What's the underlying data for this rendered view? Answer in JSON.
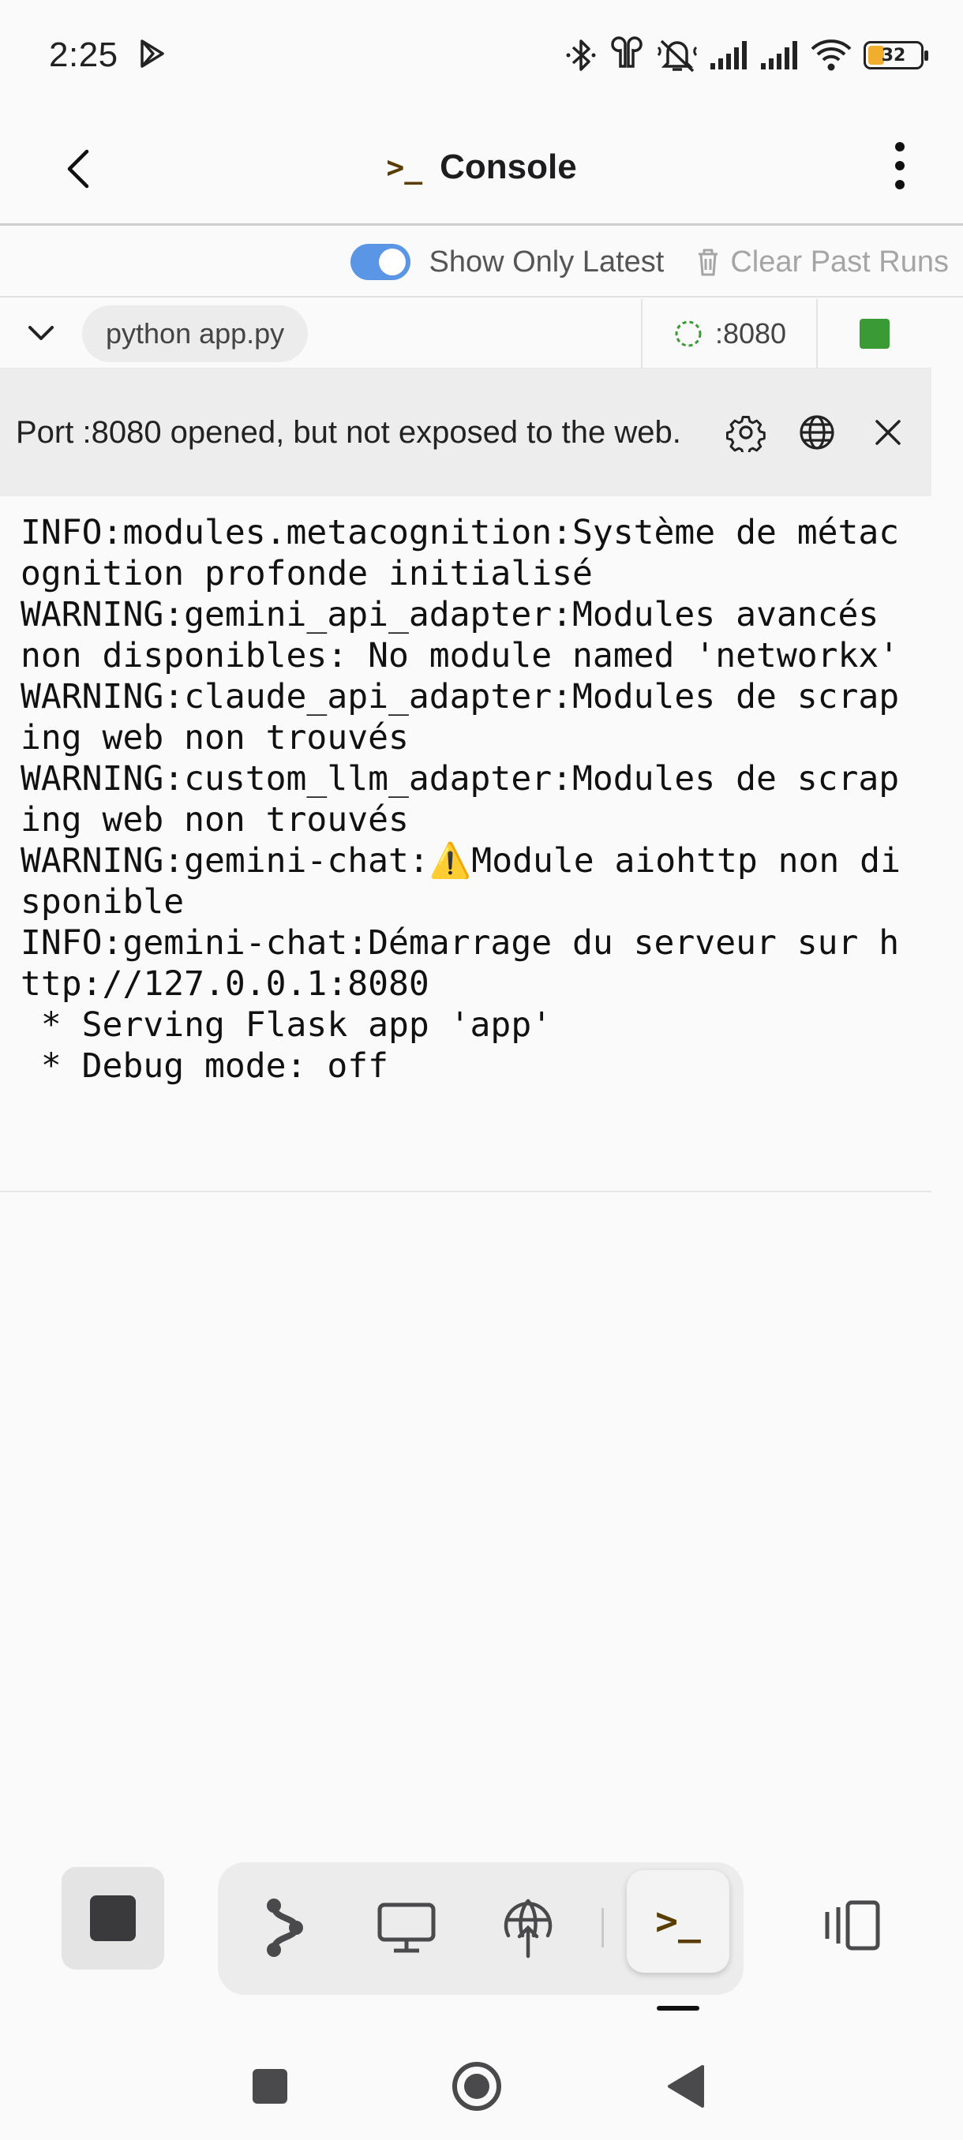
{
  "status_bar": {
    "time": "2:25",
    "battery_level": "32",
    "icons": [
      "play-store-icon",
      "bluetooth-icon",
      "earbuds-icon",
      "vibrate-icon",
      "signal-icon",
      "signal-icon",
      "wifi-icon",
      "battery-icon"
    ]
  },
  "header": {
    "title": "Console",
    "title_icon": ">_",
    "back_icon": "back-arrow-icon",
    "menu_icon": "more-vertical-icon"
  },
  "toolbar": {
    "show_only_latest_label": "Show Only Latest",
    "show_only_latest_on": true,
    "clear_label": "Clear Past Runs"
  },
  "process": {
    "command": "python app.py",
    "port": ":8080",
    "status_color": "#3a9b34"
  },
  "notice": {
    "message": "Port :8080 opened, but not exposed to the web."
  },
  "console": {
    "lines": [
      "INFO:modules.metacognition:Système de métacognition profonde initialisé",
      "WARNING:gemini_api_adapter:Modules avancés non disponibles: No module named 'networkx'",
      "WARNING:claude_api_adapter:Modules de scraping web non trouvés",
      "WARNING:custom_llm_adapter:Modules de scraping web non trouvés",
      "WARNING:gemini-chat:⚠️Module aiohttp non disponible",
      "INFO:gemini-chat:Démarrage du serveur sur http://127.0.0.1:8080",
      " * Serving Flask app 'app'",
      " * Debug mode: off"
    ]
  },
  "dock": {
    "tools": [
      "git-branch-icon",
      "desktop-icon",
      "deploy-icon",
      "console-icon"
    ],
    "active_tool": "console-icon",
    "console_glyph": ">_"
  },
  "colors": {
    "accent": "#5b95e6",
    "running": "#3a9b34",
    "prompt": "#5a3d00"
  }
}
